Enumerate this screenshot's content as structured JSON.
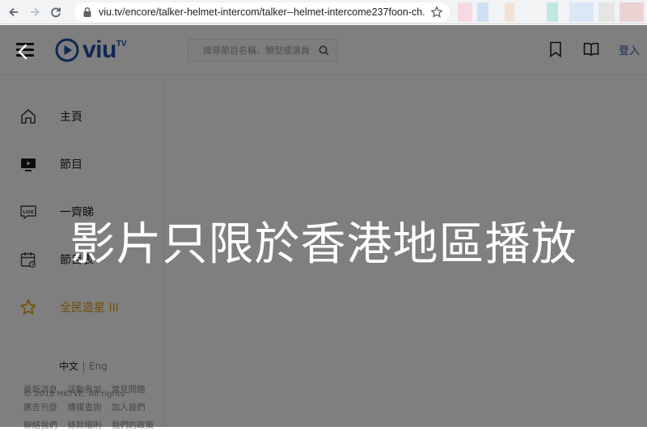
{
  "browser": {
    "url": "viu.tv/encore/talker-helmet-intercom/talker--helmet-intercome237foon-ch...",
    "extension_colors": [
      "#f7d9e6",
      "#cfe0f5",
      "#f2e2d6",
      "#bfe9de",
      "#d9e7f7",
      "#e5e5e5",
      "#ecd3d3"
    ]
  },
  "header": {
    "logo_text": "viu",
    "logo_suffix": "TV",
    "search_placeholder": "搜尋節目名稱、類型或演員",
    "login_label": "登入"
  },
  "sidebar": {
    "items": [
      {
        "label": "主頁",
        "icon": "home-icon"
      },
      {
        "label": "節目",
        "icon": "tv-icon"
      },
      {
        "label": "一齊睇",
        "icon": "live-icon"
      },
      {
        "label": "節目表",
        "icon": "calendar-icon"
      },
      {
        "label": "全民造星 III",
        "icon": "star-icon"
      }
    ],
    "lang_zh": "中文",
    "lang_en": "Eng",
    "footer_row1": [
      "最新消息",
      "活動參加",
      "常見問題"
    ],
    "footer_row2": [
      "廣告刊登",
      "傳媒查詢",
      "加入我們"
    ],
    "footer_row3": [
      "聯絡我們",
      "條款細則",
      "我們的政策"
    ],
    "copyright": "© 2018 HKTVE. All rights"
  },
  "overlay": {
    "message": "影片只限於香港地區播放"
  },
  "colors": {
    "brand_blue": "#1f4fa8",
    "fav_yellow": "#e0a000",
    "overlay": "rgba(0,0,0,0.5)"
  }
}
